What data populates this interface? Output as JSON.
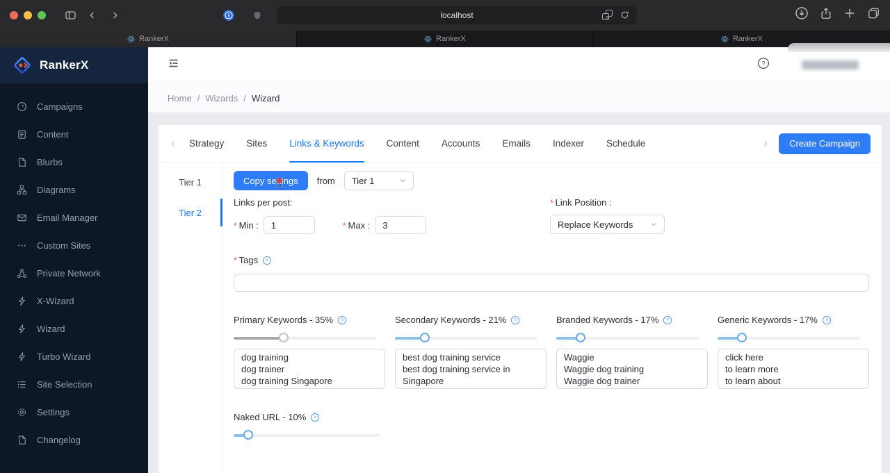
{
  "colors": {
    "accent": "#2e7cf6",
    "active_blue": "#1677ff",
    "asterisk_red": "#ff4d4f",
    "slider_track": "#efefef",
    "slider_fill_blue": "#8fc1ea",
    "slider_handle_blue": "#69a9e4",
    "slider_fill_gray": "#a9a9a9",
    "slider_handle_gray": "#c3c3c3",
    "sidebar_bg": "#0d1726",
    "sidebar_logo_bg": "#15253e"
  },
  "browser": {
    "url": "localhost",
    "tabs": [
      "RankerX",
      "RankerX",
      "RankerX"
    ]
  },
  "sidebar": {
    "brand": "RankerX",
    "items": [
      {
        "label": "Campaigns",
        "icon": "dashboard-icon"
      },
      {
        "label": "Content",
        "icon": "document-icon"
      },
      {
        "label": "Blurbs",
        "icon": "file-icon"
      },
      {
        "label": "Diagrams",
        "icon": "org-chart-icon"
      },
      {
        "label": "Email Manager",
        "icon": "envelope-icon"
      },
      {
        "label": "Custom Sites",
        "icon": "ellipsis-icon"
      },
      {
        "label": "Private Network",
        "icon": "network-icon"
      },
      {
        "label": "X-Wizard",
        "icon": "bolt-icon"
      },
      {
        "label": "Wizard",
        "icon": "bolt-icon"
      },
      {
        "label": "Turbo Wizard",
        "icon": "bolt-icon"
      },
      {
        "label": "Site Selection",
        "icon": "list-icon"
      },
      {
        "label": "Settings",
        "icon": "gear-icon"
      },
      {
        "label": "Changelog",
        "icon": "file-icon"
      }
    ]
  },
  "header": {
    "breadcrumb": [
      "Home",
      "Wizards",
      "Wizard"
    ],
    "separator": "/"
  },
  "wizard": {
    "tabs": [
      "Strategy",
      "Sites",
      "Links & Keywords",
      "Content",
      "Accounts",
      "Emails",
      "Indexer",
      "Schedule"
    ],
    "active_tab": "Links & Keywords",
    "create_button_label": "Create Campaign",
    "tiers": [
      "Tier 1",
      "Tier 2"
    ],
    "active_tier": "Tier 2",
    "copy_row": {
      "button_label": "Copy settings",
      "from_label": "from",
      "tier_select_value": "Tier 1"
    },
    "links_per_post_label": "Links per post:",
    "min_label": "Min :",
    "min_value": "1",
    "max_label": "Max :",
    "max_value": "3",
    "link_position_label": "Link Position :",
    "link_position_value": "Replace Keywords",
    "tags_label": "Tags",
    "tags_value": "",
    "keyword_groups": [
      {
        "label": "Primary Keywords - 35%",
        "percent": 35,
        "style": "gray",
        "keywords": "dog training\ndog trainer\ndog training Singapore"
      },
      {
        "label": "Secondary Keywords - 21%",
        "percent": 21,
        "style": "blue",
        "keywords": "best dog training service\nbest dog training service in Singapore\ndog training services in Singapore"
      },
      {
        "label": "Branded Keywords - 17%",
        "percent": 17,
        "style": "blue",
        "keywords": "Waggie\nWaggie dog training\nWaggie dog trainer"
      },
      {
        "label": "Generic Keywords - 17%",
        "percent": 17,
        "style": "blue",
        "keywords": "click here\nto learn more\nto learn about"
      }
    ],
    "naked_url": {
      "label": "Naked URL - 10%",
      "percent": 10,
      "style": "blue"
    }
  }
}
